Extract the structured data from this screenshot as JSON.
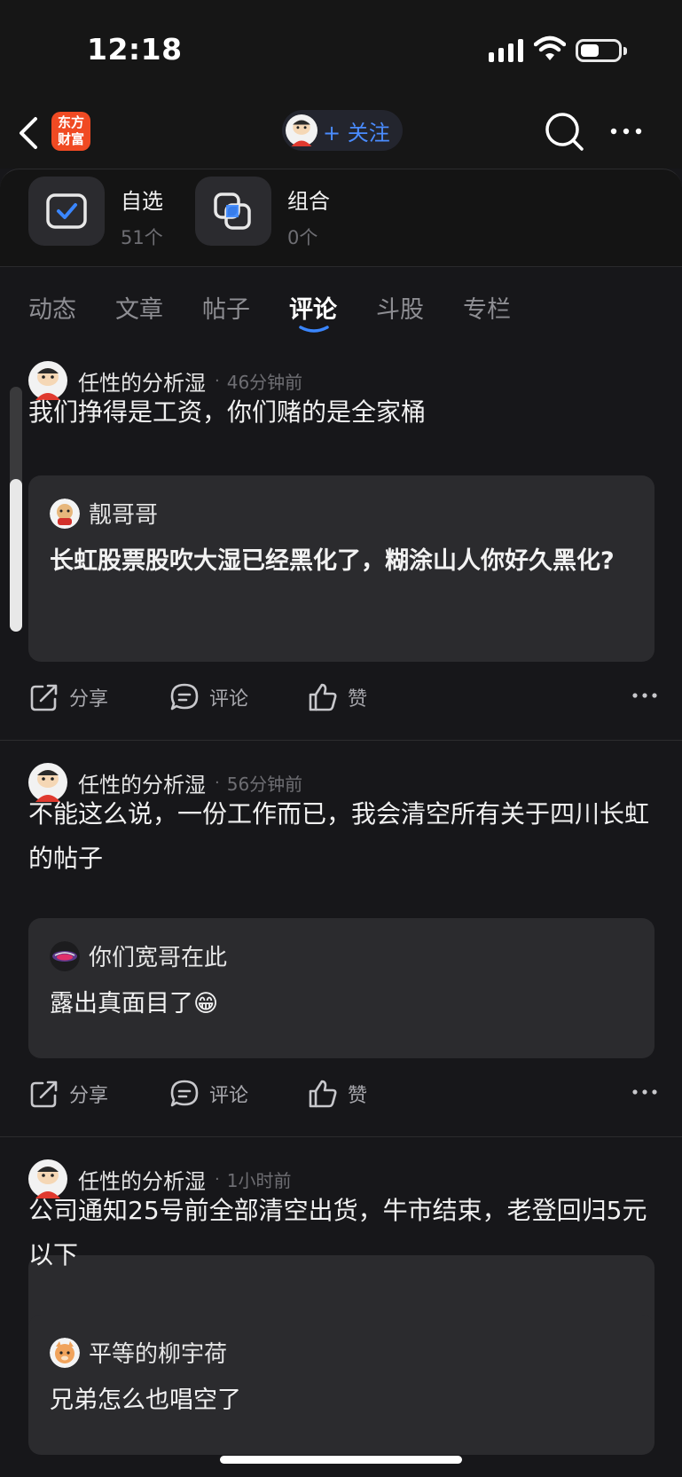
{
  "status_bar": {
    "time": "12:18"
  },
  "nav": {
    "logo_line1": "东方",
    "logo_line2": "财富",
    "follow_label": "+ 关注"
  },
  "quick_cards": [
    {
      "title": "自选",
      "count": "51个"
    },
    {
      "title": "组合",
      "count": "0个"
    }
  ],
  "tabs": [
    {
      "label": "动态"
    },
    {
      "label": "文章"
    },
    {
      "label": "帖子"
    },
    {
      "label": "评论",
      "active": true
    },
    {
      "label": "斗股"
    },
    {
      "label": "专栏"
    }
  ],
  "posts": [
    {
      "author": "任性的分析湿",
      "time": "46分钟前",
      "text": "我们挣得是工资，你们赌的是全家桶",
      "quote": {
        "name": "靓哥哥",
        "text": "长虹股票股吹大湿已经黑化了，糊涂山人你好久黑化?"
      }
    },
    {
      "author": "任性的分析湿",
      "time": "56分钟前",
      "text": "不能这么说，一份工作而已，我会清空所有关于四川长虹的帖子",
      "quote": {
        "name": "你们宽哥在此",
        "text": "露出真面目了😁"
      }
    },
    {
      "author": "任性的分析湿",
      "time": "1小时前",
      "text": "公司通知25号前全部清空出货，牛市结束，老登回归5元以下",
      "quote": {
        "name": "平等的柳宇荷",
        "text": "兄弟怎么也唱空了"
      }
    }
  ],
  "actions": {
    "share": "分享",
    "comment": "评论",
    "like": "赞"
  },
  "colors": {
    "accent": "#4a8cff",
    "logo": "#f04a23",
    "background": "#17171a"
  }
}
